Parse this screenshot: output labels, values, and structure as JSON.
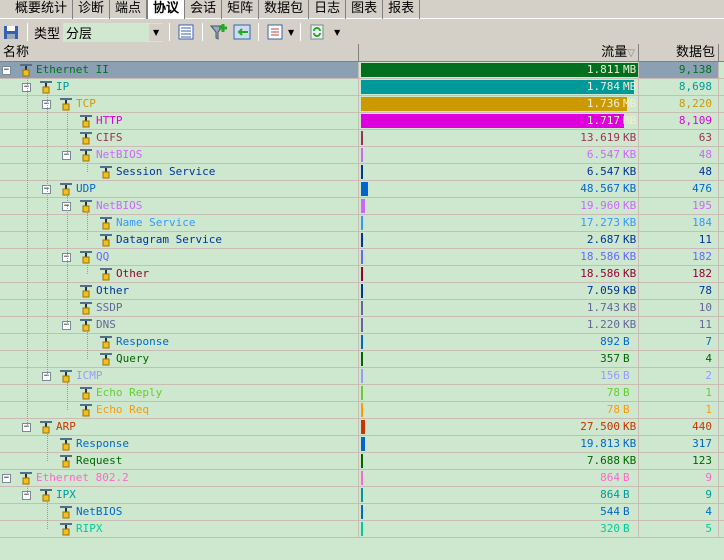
{
  "tabs": [
    "概要统计",
    "诊断",
    "端点",
    "协议",
    "会话",
    "矩阵",
    "数据包",
    "日志",
    "图表",
    "报表"
  ],
  "active_tab": "协议",
  "toolbar": {
    "type_label": "类型",
    "type_value": "分层"
  },
  "columns": {
    "name": "名称",
    "traffic": "流量",
    "packets": "数据包"
  },
  "icons": {
    "save": "save-icon",
    "list": "list-view-icon",
    "filter_add": "filter-add-icon",
    "export": "export-icon",
    "columns": "columns-icon",
    "refresh": "refresh-icon"
  },
  "rows": [
    {
      "name": "Ethernet II",
      "level": 0,
      "expander": true,
      "value": "1.811",
      "unit": "MB",
      "packets": "9,138",
      "color": "#007020",
      "bar": 1.0,
      "bar_color": "#007020",
      "selected": true
    },
    {
      "name": "IP",
      "level": 1,
      "expander": true,
      "value": "1.784",
      "unit": "MB",
      "packets": "8,698",
      "color": "#009999",
      "bar": 0.985,
      "bar_color": "#009999"
    },
    {
      "name": "TCP",
      "level": 2,
      "expander": true,
      "value": "1.736",
      "unit": "MB",
      "packets": "8,220",
      "color": "#cc9900",
      "bar": 0.959,
      "bar_color": "#cc9900"
    },
    {
      "name": "HTTP",
      "level": 3,
      "expander": false,
      "value": "1.717",
      "unit": "MB",
      "packets": "8,109",
      "color": "#dd00dd",
      "bar": 0.948,
      "bar_color": "#dd00dd"
    },
    {
      "name": "CIFS",
      "level": 3,
      "expander": false,
      "value": "13.619",
      "unit": "KB",
      "packets": "63",
      "color": "#993355",
      "bar": 0.0073,
      "bar_color": "#993355"
    },
    {
      "name": "NetBIOS",
      "level": 3,
      "expander": true,
      "value": "6.547",
      "unit": "KB",
      "packets": "48",
      "color": "#cc66ff",
      "bar": 0.0035,
      "bar_color": "#cc66ff"
    },
    {
      "name": "Session Service",
      "level": 4,
      "expander": false,
      "value": "6.547",
      "unit": "KB",
      "packets": "48",
      "color": "#003399",
      "bar": 0.0035,
      "bar_color": "#003399"
    },
    {
      "name": "UDP",
      "level": 2,
      "expander": true,
      "value": "48.567",
      "unit": "KB",
      "packets": "476",
      "color": "#0066cc",
      "bar": 0.026,
      "bar_color": "#0066cc"
    },
    {
      "name": "NetBIOS",
      "level": 3,
      "expander": true,
      "value": "19.960",
      "unit": "KB",
      "packets": "195",
      "color": "#cc66ff",
      "bar": 0.011,
      "bar_color": "#cc66ff"
    },
    {
      "name": "Name Service",
      "level": 4,
      "expander": false,
      "value": "17.273",
      "unit": "KB",
      "packets": "184",
      "color": "#3399ff",
      "bar": 0.0093,
      "bar_color": "#3399ff"
    },
    {
      "name": "Datagram Service",
      "level": 4,
      "expander": false,
      "value": "2.687",
      "unit": "KB",
      "packets": "11",
      "color": "#003399",
      "bar": 0.0014,
      "bar_color": "#003399"
    },
    {
      "name": "QQ",
      "level": 3,
      "expander": true,
      "value": "18.586",
      "unit": "KB",
      "packets": "182",
      "color": "#6666ff",
      "bar": 0.01,
      "bar_color": "#6666ff"
    },
    {
      "name": "Other",
      "level": 4,
      "expander": false,
      "value": "18.586",
      "unit": "KB",
      "packets": "182",
      "color": "#990033",
      "bar": 0.01,
      "bar_color": "#990033"
    },
    {
      "name": "Other",
      "level": 3,
      "expander": false,
      "value": "7.059",
      "unit": "KB",
      "packets": "78",
      "color": "#003399",
      "bar": 0.0038,
      "bar_color": "#003399"
    },
    {
      "name": "SSDP",
      "level": 3,
      "expander": false,
      "value": "1.743",
      "unit": "KB",
      "packets": "10",
      "color": "#666699",
      "bar": 0.0009,
      "bar_color": "#666699"
    },
    {
      "name": "DNS",
      "level": 3,
      "expander": true,
      "value": "1.220",
      "unit": "KB",
      "packets": "11",
      "color": "#666699",
      "bar": 0.0007,
      "bar_color": "#666699"
    },
    {
      "name": "Response",
      "level": 4,
      "expander": false,
      "value": "892",
      "unit": "B",
      "packets": "7",
      "color": "#0066cc",
      "bar": 0.0005,
      "bar_color": "#0066cc"
    },
    {
      "name": "Query",
      "level": 4,
      "expander": false,
      "value": "357",
      "unit": "B",
      "packets": "4",
      "color": "#006600",
      "bar": 0.0002,
      "bar_color": "#006600"
    },
    {
      "name": "ICMP",
      "level": 2,
      "expander": true,
      "value": "156",
      "unit": "B",
      "packets": "2",
      "color": "#9999ff",
      "bar": 0.0001,
      "bar_color": "#9999ff"
    },
    {
      "name": "Echo Reply",
      "level": 3,
      "expander": false,
      "value": "78",
      "unit": "B",
      "packets": "1",
      "color": "#66cc33",
      "bar": 0.0001,
      "bar_color": "#66cc33"
    },
    {
      "name": "Echo Req",
      "level": 3,
      "expander": false,
      "value": "78",
      "unit": "B",
      "packets": "1",
      "color": "#ff9900",
      "bar": 0.0001,
      "bar_color": "#ff9900"
    },
    {
      "name": "ARP",
      "level": 1,
      "expander": true,
      "value": "27.500",
      "unit": "KB",
      "packets": "440",
      "color": "#cc3300",
      "bar": 0.015,
      "bar_color": "#cc3300"
    },
    {
      "name": "Response",
      "level": 2,
      "expander": false,
      "value": "19.813",
      "unit": "KB",
      "packets": "317",
      "color": "#0066cc",
      "bar": 0.011,
      "bar_color": "#0066cc"
    },
    {
      "name": "Request",
      "level": 2,
      "expander": false,
      "value": "7.688",
      "unit": "KB",
      "packets": "123",
      "color": "#006600",
      "bar": 0.0041,
      "bar_color": "#006600"
    },
    {
      "name": "Ethernet 802.2",
      "level": 0,
      "expander": true,
      "value": "864",
      "unit": "B",
      "packets": "9",
      "color": "#ff66cc",
      "bar": 0.0005,
      "bar_color": "#ff66cc"
    },
    {
      "name": "IPX",
      "level": 1,
      "expander": true,
      "value": "864",
      "unit": "B",
      "packets": "9",
      "color": "#009999",
      "bar": 0.0005,
      "bar_color": "#009999"
    },
    {
      "name": "NetBIOS",
      "level": 2,
      "expander": false,
      "value": "544",
      "unit": "B",
      "packets": "4",
      "color": "#0066cc",
      "bar": 0.0003,
      "bar_color": "#0066cc"
    },
    {
      "name": "RIPX",
      "level": 2,
      "expander": false,
      "value": "320",
      "unit": "B",
      "packets": "5",
      "color": "#00cc99",
      "bar": 0.0002,
      "bar_color": "#00cc99"
    }
  ]
}
